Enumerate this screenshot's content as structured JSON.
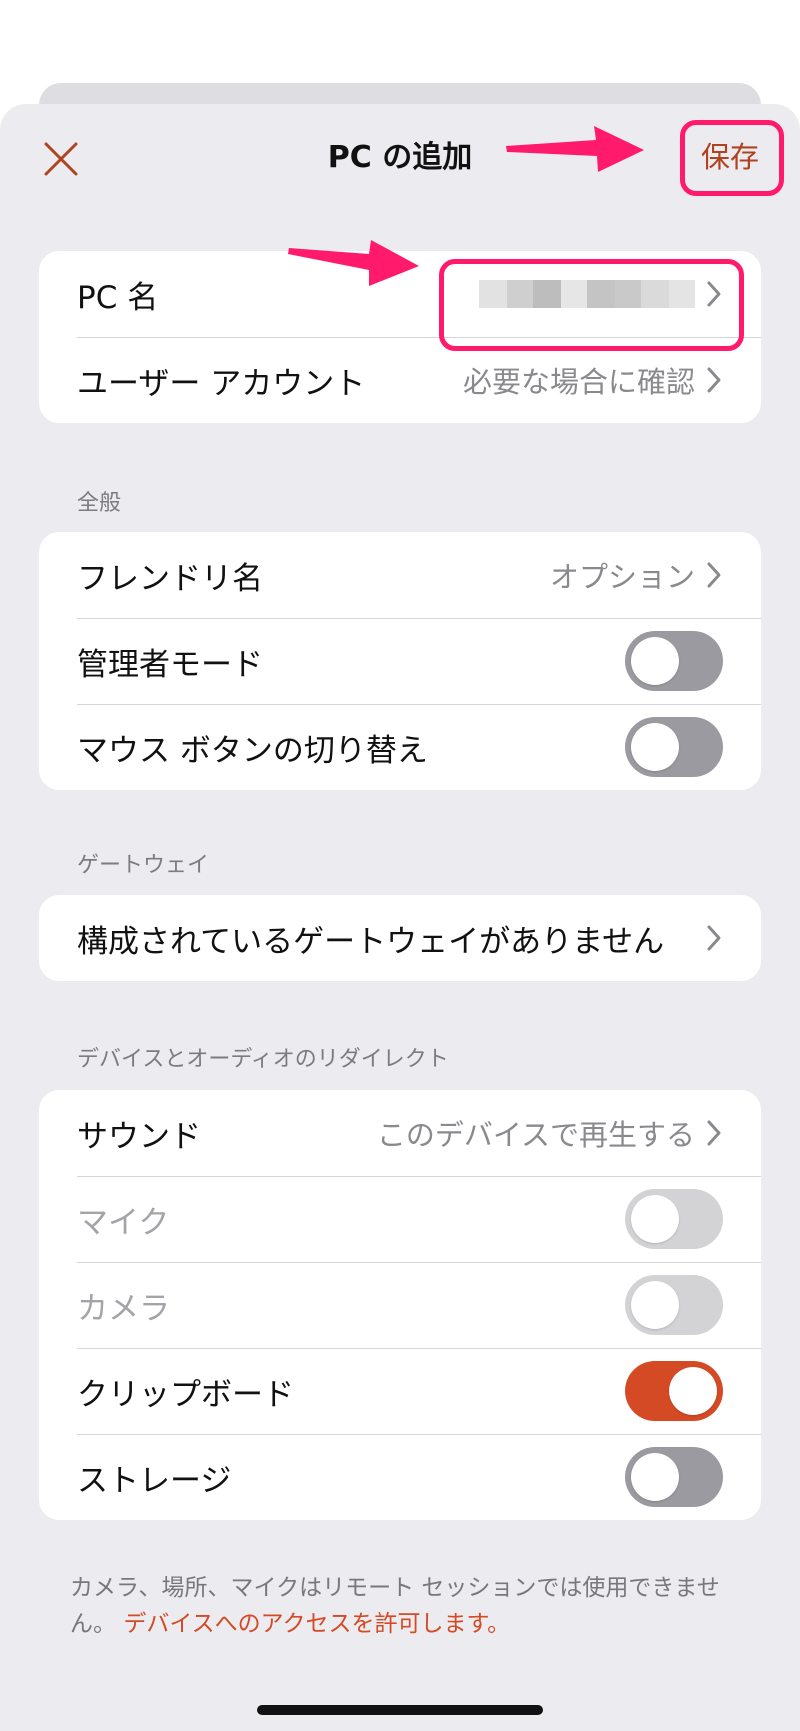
{
  "header": {
    "title": "PC の追加",
    "save_label": "保存",
    "close_icon": "close-icon"
  },
  "connection": {
    "pc_name_label": "PC 名",
    "pc_name_value_blurred": true,
    "user_account_label": "ユーザー アカウント",
    "user_account_value": "必要な場合に確認"
  },
  "general": {
    "header": "全般",
    "friendly_name_label": "フレンドリ名",
    "friendly_name_value": "オプション",
    "admin_mode_label": "管理者モード",
    "admin_mode_on": false,
    "swap_mouse_label": "マウス ボタンの切り替え",
    "swap_mouse_on": false
  },
  "gateway": {
    "header": "ゲートウェイ",
    "none_label": "構成されているゲートウェイがありません"
  },
  "redirection": {
    "header": "デバイスとオーディオのリダイレクト",
    "sound_label": "サウンド",
    "sound_value": "このデバイスで再生する",
    "mic_label": "マイク",
    "mic_on": false,
    "mic_disabled": true,
    "camera_label": "カメラ",
    "camera_on": false,
    "camera_disabled": true,
    "clipboard_label": "クリップボード",
    "clipboard_on": true,
    "storage_label": "ストレージ",
    "storage_on": false
  },
  "footer": {
    "note": "カメラ、場所、マイクはリモート セッションでは使用できません。 ",
    "link": "デバイスへのアクセスを許可します。"
  },
  "colors": {
    "accent": "#d44a25",
    "annotation": "#ff1a6c",
    "background": "#ececf0"
  }
}
